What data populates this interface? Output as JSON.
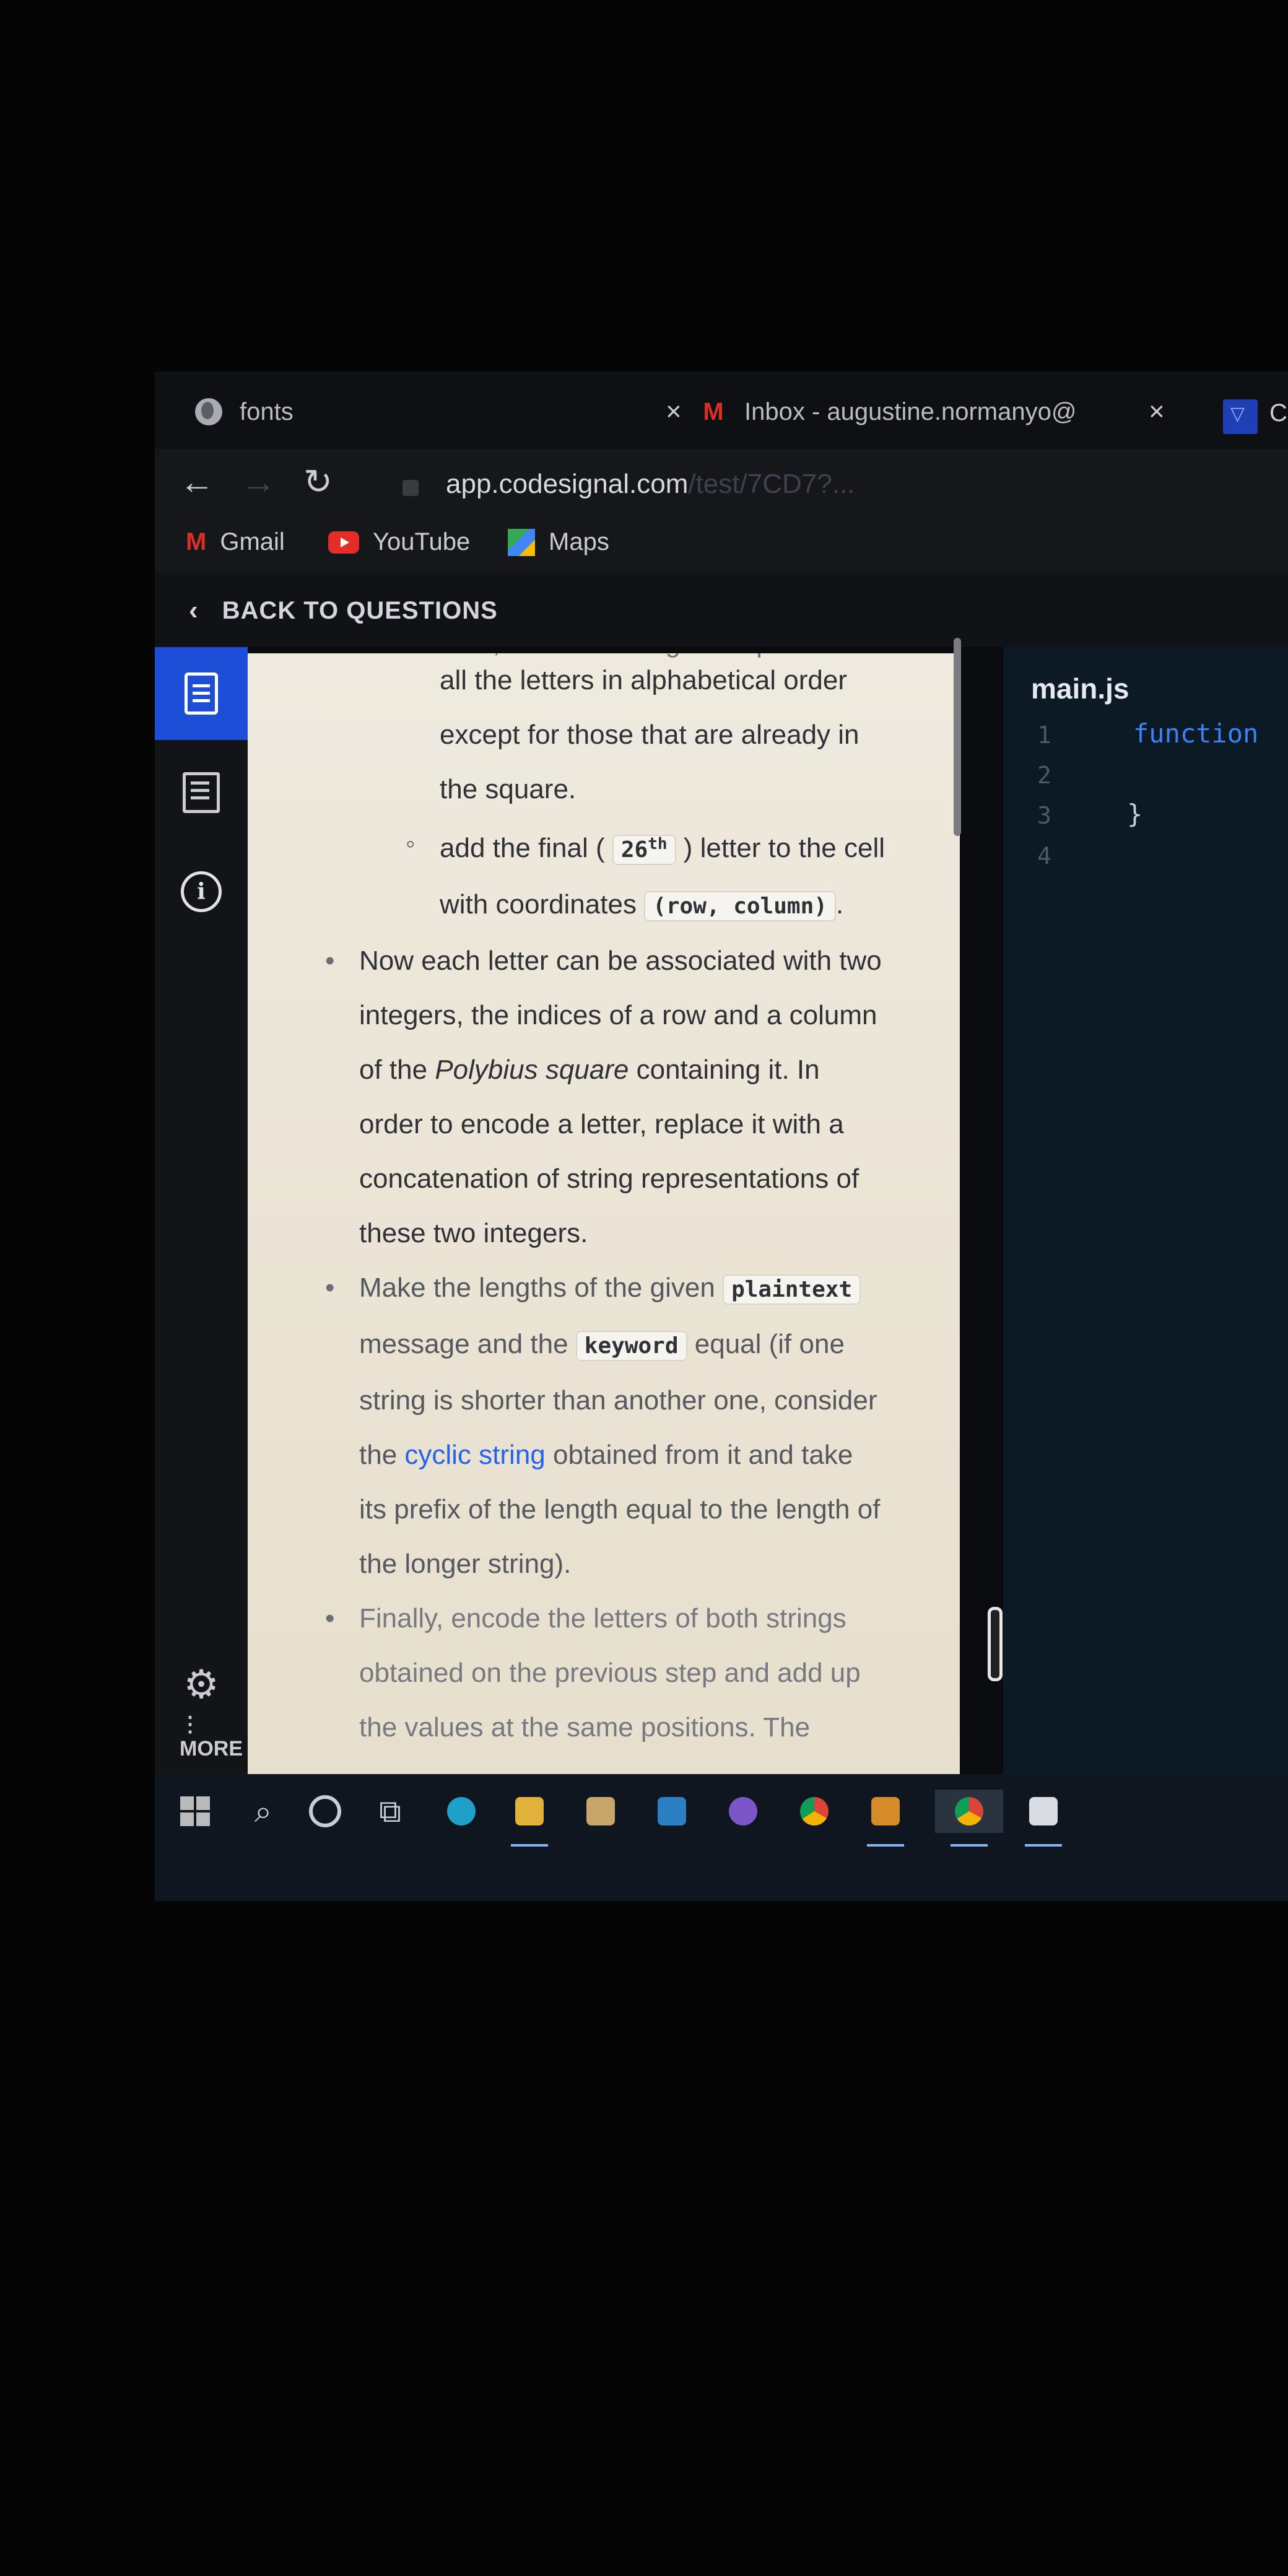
{
  "browser": {
    "tabs": [
      {
        "title": "fonts",
        "icon": "globe-icon"
      },
      {
        "title": "Inbox - augustine.normanyo@",
        "icon": "gmail-icon"
      }
    ],
    "partial_tab": "C",
    "close_glyph": "×",
    "url": "app.codesignal.com",
    "url_rest": "/test/7CD7?..."
  },
  "bookmarks": [
    {
      "label": "Gmail",
      "icon": "gmail-icon"
    },
    {
      "label": "YouTube",
      "icon": "youtube-icon"
    },
    {
      "label": "Maps",
      "icon": "maps-icon"
    }
  ],
  "app": {
    "back_label": "BACK TO QUESTIONS",
    "more_label": "MORE"
  },
  "description": {
    "clipped_top": "then, continue filling the square with",
    "sub1_a": "all the letters in alphabetical order",
    "sub1_b": "except for those that are already in",
    "sub1_c": "the square.",
    "sub2_a": "add the final (",
    "sub2_code": "26",
    "sub2_sup": "th",
    "sub2_b": ") letter to the cell",
    "sub2_c": "with coordinates",
    "sub2_code2": "(row, column)",
    "sub2_end": ".",
    "b1_a": "Now each letter can be associated with two",
    "b1_b": "integers, the indices of a row and a column",
    "b1_c1": "of the ",
    "b1_c_em": "Polybius square",
    "b1_c2": " containing it. In",
    "b1_d": "order to encode a letter, replace it with a",
    "b1_e": "concatenation of string representations of",
    "b1_f": "these two integers.",
    "b2_a": "Make the lengths of the given",
    "b2_code1": "plaintext",
    "b2_b": "message and the",
    "b2_code2": "keyword",
    "b2_c": "equal (if one",
    "b2_d": "string is shorter than another one, consider",
    "b2_e1": "the ",
    "b2_link": "cyclic string",
    "b2_e2": " obtained from it and take",
    "b2_f": "its prefix of the length equal to the length of",
    "b2_g": "the longer string).",
    "b3_a": "Finally, encode the letters of both strings",
    "b3_b": "obtained on the previous step and add up",
    "b3_c": "the values at the same positions. The"
  },
  "editor": {
    "filename": "main.js",
    "line_numbers": [
      "1",
      "2",
      "3",
      "4"
    ],
    "line1": "function",
    "line3": "}"
  },
  "taskbar": [
    "windows-start-icon",
    "search-icon",
    "cortana-icon",
    "task-view-icon",
    "edge-icon",
    "file-explorer-icon",
    "store-icon",
    "mail-icon",
    "github-icon",
    "chrome-icon",
    "sublime-icon",
    "chrome-active-icon",
    "notepad-icon"
  ]
}
